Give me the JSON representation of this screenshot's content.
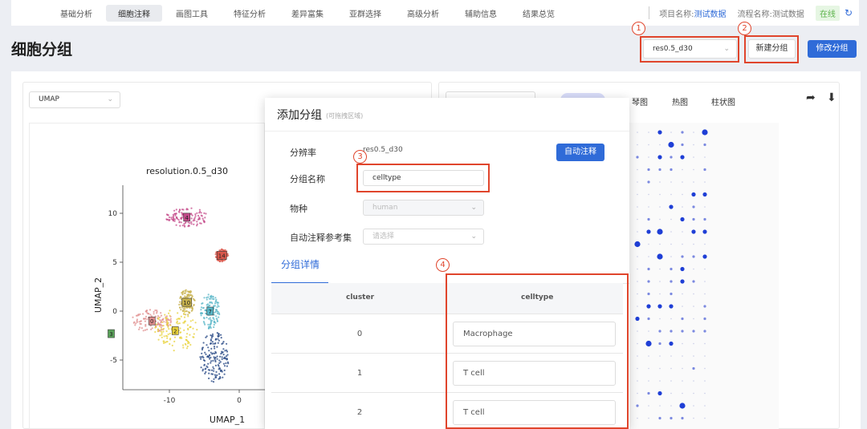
{
  "nav": {
    "tabs": [
      "基础分析",
      "细胞注释",
      "画图工具",
      "特征分析",
      "差异富集",
      "亚群选择",
      "高级分析",
      "辅助信息",
      "结果总览"
    ],
    "active_index": 1,
    "project_label": "项目名称:",
    "project_value": "测试数据",
    "flow_label": "流程名称:",
    "flow_value": "测试数据",
    "status": "在线",
    "refresh_icon": "refresh-icon"
  },
  "page": {
    "title": "细胞分组",
    "resolution_select": "res0.5_d30",
    "new_group_button": "新建分组",
    "edit_group_button": "修改分组"
  },
  "markers": [
    "1",
    "2",
    "3",
    "4"
  ],
  "left_panel": {
    "embedding_select": "UMAP"
  },
  "right_panel": {
    "tabs": [
      "琴图",
      "热图",
      "柱状图"
    ],
    "icons": [
      "share-icon",
      "download-icon"
    ]
  },
  "chart_data": {
    "type": "scatter",
    "title": "resolution.0.5_d30",
    "xlabel": "UMAP_1",
    "ylabel": "UMAP_2",
    "x_ticks": [
      -10,
      0
    ],
    "y_ticks": [
      10,
      5,
      0,
      -5
    ],
    "cluster_labels": [
      {
        "label": "4",
        "x": -4.5,
        "y": 9.6,
        "color": "#c44a8a"
      },
      {
        "label": "14",
        "x": -1.5,
        "y": 5.7,
        "color": "#d9574b"
      },
      {
        "label": "10",
        "x": -4.5,
        "y": 0.9,
        "color": "#c8b24c"
      },
      {
        "label": "7",
        "x": -2.5,
        "y": 0.0,
        "color": "#57b6c7"
      },
      {
        "label": "0",
        "x": -7.5,
        "y": -1.0,
        "color": "#e08d8d"
      },
      {
        "label": "2",
        "x": -5.5,
        "y": -2.0,
        "color": "#e8d13a"
      },
      {
        "label": "3",
        "x": -11.0,
        "y": -2.3,
        "color": "#5aa35a"
      }
    ]
  },
  "modal": {
    "title": "添加分组",
    "hint": "(可拖拽区域)",
    "resolution_label": "分辨率",
    "resolution_value": "res0.5_d30",
    "auto_button": "自动注释",
    "group_name_label": "分组名称",
    "group_name_value": "celltype",
    "species_label": "物种",
    "species_value": "human",
    "ref_label": "自动注释参考集",
    "ref_placeholder": "请选择",
    "section_tab": "分组详情",
    "table": {
      "headers": [
        "cluster",
        "celltype"
      ],
      "rows": [
        {
          "cluster": "0",
          "celltype": "Macrophage"
        },
        {
          "cluster": "1",
          "celltype": "T cell"
        },
        {
          "cluster": "2",
          "celltype": "T cell"
        }
      ]
    }
  }
}
